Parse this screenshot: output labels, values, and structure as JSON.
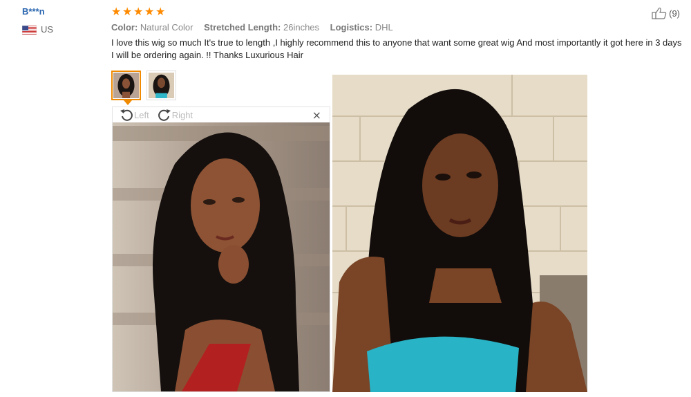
{
  "reviewer": {
    "name": "B***n",
    "country": "US"
  },
  "review": {
    "rating": 5,
    "meta": [
      {
        "key": "Color:",
        "value": "Natural Color"
      },
      {
        "key": "Stretched Length:",
        "value": "26inches"
      },
      {
        "key": "Logistics:",
        "value": "DHL"
      }
    ],
    "text": "I love this wig so much It's true to length ,I highly recommend this to anyone that want some great wig And most importantly it got here in 3 days I will be ordering again. !! Thanks Luxurious Hair",
    "helpful_count": "(9)"
  },
  "viewer": {
    "rotate_left": "Left",
    "rotate_right": "Right",
    "close": "×"
  },
  "icons": {
    "star": "star-icon",
    "flag": "us-flag-icon",
    "thumb": "thumbs-up-icon"
  },
  "colors": {
    "name": "#2a66b0",
    "star": "#ff8a00",
    "active_border": "#f08a00"
  }
}
